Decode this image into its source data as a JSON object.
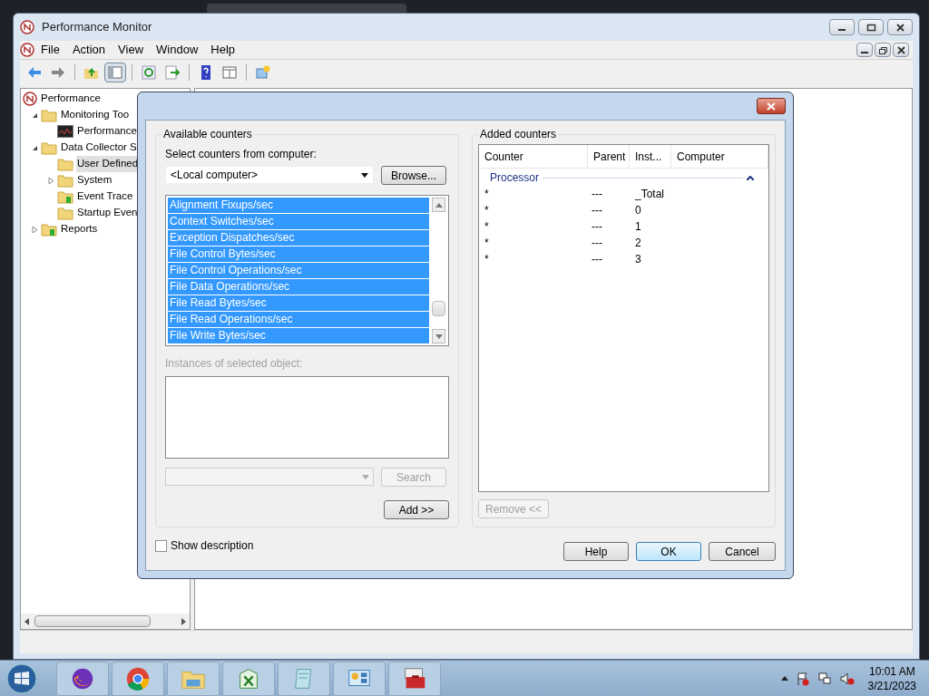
{
  "window": {
    "title": "Performance Monitor"
  },
  "menu": [
    "File",
    "Action",
    "View",
    "Window",
    "Help"
  ],
  "toolbar": [
    {
      "kind": "back",
      "pressed": false
    },
    {
      "kind": "forward",
      "pressed": false
    },
    {
      "kind": "sep"
    },
    {
      "kind": "up",
      "pressed": false
    },
    {
      "kind": "tree",
      "pressed": true
    },
    {
      "kind": "sep"
    },
    {
      "kind": "refresh",
      "pressed": false
    },
    {
      "kind": "export",
      "pressed": false
    },
    {
      "kind": "sep"
    },
    {
      "kind": "help",
      "pressed": false
    },
    {
      "kind": "pane",
      "pressed": false
    },
    {
      "kind": "sep"
    },
    {
      "kind": "new",
      "pressed": false
    }
  ],
  "tree": [
    {
      "label": "Performance",
      "kind": "perf",
      "selected": false,
      "children": [
        {
          "label": "Monitoring Too",
          "kind": "folder",
          "expanded": true,
          "selected": false,
          "children": [
            {
              "label": "Performance",
              "kind": "graph",
              "selected": false
            }
          ]
        },
        {
          "label": "Data Collector S",
          "kind": "folder",
          "expanded": true,
          "selected": false,
          "children": [
            {
              "label": "User Defined",
              "kind": "folder",
              "selected": true
            },
            {
              "label": "System",
              "kind": "folder",
              "expanded": false,
              "selected": false
            },
            {
              "label": "Event Trace",
              "kind": "folder",
              "selected": false
            },
            {
              "label": "Startup Even",
              "kind": "folder",
              "selected": false
            }
          ]
        },
        {
          "label": "Reports",
          "kind": "folder",
          "expanded": false,
          "selected": false
        }
      ]
    }
  ],
  "dialog": {
    "available": {
      "title": "Available counters",
      "computer_label": "Select counters from computer:",
      "computer": "<Local computer>",
      "browse": "Browse...",
      "counters": [
        {
          "label": "Alignment Fixups/sec",
          "selected": true
        },
        {
          "label": "Context Switches/sec",
          "selected": true
        },
        {
          "label": "Exception Dispatches/sec",
          "selected": true
        },
        {
          "label": "File Control Bytes/sec",
          "selected": true
        },
        {
          "label": "File Control Operations/sec",
          "selected": true
        },
        {
          "label": "File Data Operations/sec",
          "selected": true
        },
        {
          "label": "File Read Bytes/sec",
          "selected": true
        },
        {
          "label": "File Read Operations/sec",
          "selected": true
        },
        {
          "label": "File Write Bytes/sec",
          "selected": true
        }
      ],
      "instances_label": {
        "text": "Instances of selected object:",
        "disabled": true
      },
      "search": {
        "label": "Search",
        "disabled": true
      },
      "add": {
        "label": "Add >>",
        "disabled": false
      }
    },
    "added": {
      "title": "Added counters",
      "columns": [
        "Counter",
        "Parent",
        "Inst...",
        "Computer"
      ],
      "group": {
        "label": "Processor",
        "expanded": true
      },
      "rows": [
        [
          "*",
          "---",
          "_Total"
        ],
        [
          "*",
          "---",
          "0"
        ],
        [
          "*",
          "---",
          "1"
        ],
        [
          "*",
          "---",
          "2"
        ],
        [
          "*",
          "---",
          "3"
        ]
      ],
      "remove": {
        "label": "Remove <<",
        "disabled": true
      }
    },
    "show_description": {
      "label": "Show description",
      "checked": false
    },
    "buttons": [
      {
        "label": "Help",
        "default": false
      },
      {
        "label": "OK",
        "default": true
      },
      {
        "label": "Cancel",
        "default": false
      }
    ]
  },
  "taskbar": {
    "apps": [
      {
        "kind": "firefox"
      },
      {
        "kind": "chrome"
      },
      {
        "kind": "explorer"
      },
      {
        "kind": "excel"
      },
      {
        "kind": "notepad"
      },
      {
        "kind": "control"
      },
      {
        "kind": "toolbox"
      }
    ],
    "time": "10:01 AM",
    "date": "3/21/2023"
  }
}
